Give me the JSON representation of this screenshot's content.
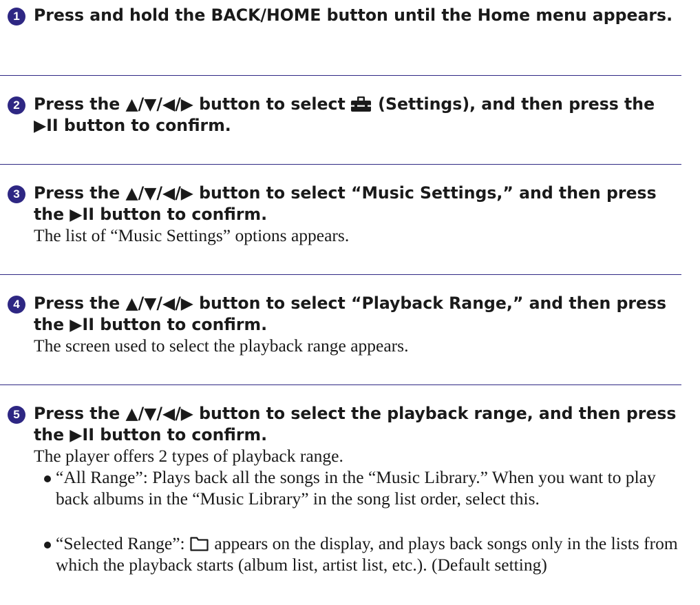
{
  "steps": [
    {
      "number": "1",
      "heading": "Press and hold the BACK/HOME button until the Home menu appears."
    },
    {
      "number": "2",
      "heading_before_icon": "Press the ▲/▼/◀/▶ button to select",
      "icon": "settings-toolbox-icon",
      "heading_after_icon": "(Settings), and then press the ▶II button to confirm."
    },
    {
      "number": "3",
      "heading": "Press the ▲/▼/◀/▶ button to select “Music Settings,” and then press the ▶II button to confirm.",
      "description": "The list of “Music Settings” options appears."
    },
    {
      "number": "4",
      "heading": "Press the ▲/▼/◀/▶ button to select “Playback Range,” and then press the ▶II button to confirm.",
      "description": "The screen used to select the playback range appears."
    },
    {
      "number": "5",
      "heading": "Press the ▲/▼/◀/▶ button to select the playback range, and then press the ▶II button to confirm.",
      "description": "The player offers 2 types of playback range.",
      "bullets": [
        {
          "text": "“All Range”: Plays back all the songs in the “Music Library.” When you want to play back albums in the “Music Library” in the song list order, select this."
        },
        {
          "text_before_icon": "“Selected Range”:",
          "icon": "folder-icon",
          "text_after_icon": "appears on the display, and plays back songs only in the lists from which the playback starts (album list, artist list, etc.). (Default setting)"
        }
      ]
    }
  ],
  "colors": {
    "accent": "#2e2783",
    "text": "#1a1a1a",
    "background": "#ffffff"
  }
}
